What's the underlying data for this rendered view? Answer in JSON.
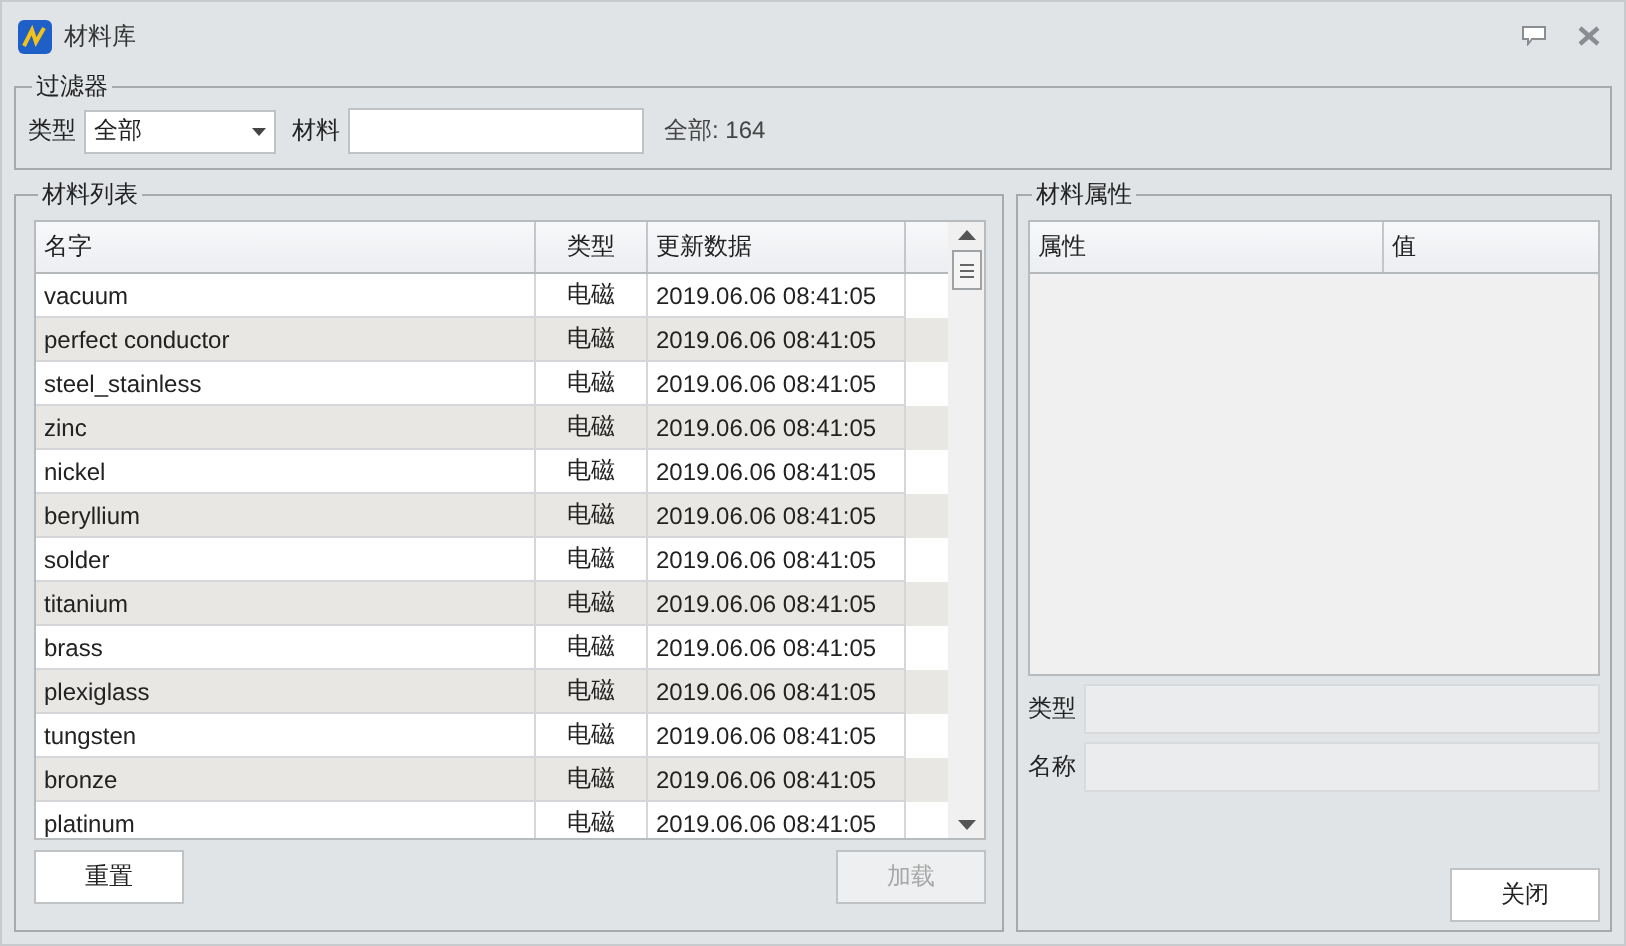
{
  "window": {
    "title": "材料库"
  },
  "filter": {
    "title": "过滤器",
    "type_label": "类型",
    "type_value": "全部",
    "material_label": "材料",
    "count": "全部: 164"
  },
  "material_list": {
    "title": "材料列表",
    "columns": [
      "名字",
      "类型",
      "更新数据"
    ],
    "rows": [
      {
        "name": "vacuum",
        "type": "电磁",
        "updated": "2019.06.06 08:41:05"
      },
      {
        "name": "perfect conductor",
        "type": "电磁",
        "updated": "2019.06.06 08:41:05"
      },
      {
        "name": "steel_stainless",
        "type": "电磁",
        "updated": "2019.06.06 08:41:05"
      },
      {
        "name": "zinc",
        "type": "电磁",
        "updated": "2019.06.06 08:41:05"
      },
      {
        "name": "nickel",
        "type": "电磁",
        "updated": "2019.06.06 08:41:05"
      },
      {
        "name": "beryllium",
        "type": "电磁",
        "updated": "2019.06.06 08:41:05"
      },
      {
        "name": "solder",
        "type": "电磁",
        "updated": "2019.06.06 08:41:05"
      },
      {
        "name": "titanium",
        "type": "电磁",
        "updated": "2019.06.06 08:41:05"
      },
      {
        "name": "brass",
        "type": "电磁",
        "updated": "2019.06.06 08:41:05"
      },
      {
        "name": "plexiglass",
        "type": "电磁",
        "updated": "2019.06.06 08:41:05"
      },
      {
        "name": "tungsten",
        "type": "电磁",
        "updated": "2019.06.06 08:41:05"
      },
      {
        "name": "bronze",
        "type": "电磁",
        "updated": "2019.06.06 08:41:05"
      },
      {
        "name": "platinum",
        "type": "电磁",
        "updated": "2019.06.06 08:41:05"
      }
    ],
    "buttons": [
      {
        "label": "重置",
        "disabled": false
      },
      {
        "label": "加载",
        "disabled": true
      }
    ]
  },
  "properties": {
    "title": "材料属性",
    "columns": [
      "属性",
      "值"
    ],
    "type_label": "类型",
    "name_label": "名称",
    "buttons": [
      {
        "label": "关闭",
        "disabled": false
      }
    ]
  }
}
